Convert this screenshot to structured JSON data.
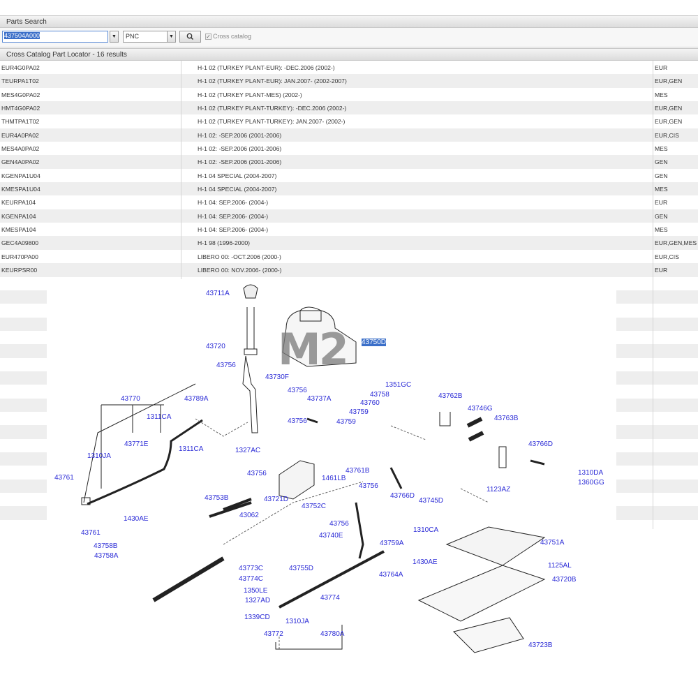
{
  "header": {
    "title": "Parts Search"
  },
  "search": {
    "value": "437504A000",
    "dropdown_value": "PNC",
    "cross_catalog_checked": true,
    "cross_catalog_label": "Cross catalog"
  },
  "results": {
    "title": "Cross Catalog Part Locator - 16 results",
    "rows": [
      {
        "catalog": "EUR4G0PA02",
        "model": "H-1 02 (TURKEY PLANT-EUR): -DEC.2006 (2002-)",
        "region": "EUR"
      },
      {
        "catalog": "TEURPA1T02",
        "model": "H-1 02 (TURKEY PLANT-EUR): JAN.2007- (2002-2007)",
        "region": "EUR,GEN"
      },
      {
        "catalog": "MES4G0PA02",
        "model": "H-1 02 (TURKEY PLANT-MES) (2002-)",
        "region": "MES"
      },
      {
        "catalog": "HMT4G0PA02",
        "model": "H-1 02 (TURKEY PLANT-TURKEY): -DEC.2006 (2002-)",
        "region": "EUR,GEN"
      },
      {
        "catalog": "THMTPA1T02",
        "model": "H-1 02 (TURKEY PLANT-TURKEY): JAN.2007- (2002-)",
        "region": "EUR,GEN"
      },
      {
        "catalog": "EUR4A0PA02",
        "model": "H-1 02: -SEP.2006 (2001-2006)",
        "region": "EUR,CIS"
      },
      {
        "catalog": "MES4A0PA02",
        "model": "H-1 02: -SEP.2006 (2001-2006)",
        "region": "MES"
      },
      {
        "catalog": "GEN4A0PA02",
        "model": "H-1 02: -SEP.2006 (2001-2006)",
        "region": "GEN"
      },
      {
        "catalog": "KGENPA1U04",
        "model": "H-1 04 SPECIAL (2004-2007)",
        "region": "GEN"
      },
      {
        "catalog": "KMESPA1U04",
        "model": "H-1 04 SPECIAL (2004-2007)",
        "region": "MES"
      },
      {
        "catalog": "KEURPA104",
        "model": "H-1 04: SEP.2006- (2004-)",
        "region": "EUR"
      },
      {
        "catalog": "KGENPA104",
        "model": "H-1 04: SEP.2006- (2004-)",
        "region": "GEN"
      },
      {
        "catalog": "KMESPA104",
        "model": "H-1 04: SEP.2006- (2004-)",
        "region": "MES"
      },
      {
        "catalog": "GEC4A09800",
        "model": "H-1 98 (1996-2000)",
        "region": "EUR,GEN,MES"
      },
      {
        "catalog": "EUR470PA00",
        "model": "LIBERO 00: -OCT.2006 (2000-)",
        "region": "EUR,CIS"
      },
      {
        "catalog": "KEURPSR00",
        "model": "LIBERO 00: NOV.2006- (2000-)",
        "region": "EUR"
      }
    ]
  },
  "diagram": {
    "watermark": "M2",
    "highlighted_part": "43750D",
    "parts": [
      "43711A",
      "43720",
      "43756",
      "43730F",
      "43756",
      "43737A",
      "1351GC",
      "43758",
      "43760",
      "43759",
      "43762B",
      "43746G",
      "43763B",
      "43770",
      "43789A",
      "1311CA",
      "43756",
      "43759",
      "43771E",
      "1311CA",
      "1327AC",
      "43766D",
      "1310JA",
      "1310DA",
      "1360GG",
      "43761",
      "43756",
      "1461LB",
      "43761B",
      "1123AZ",
      "43756",
      "43766D",
      "43745D",
      "43753B",
      "43721D",
      "43752C",
      "43062",
      "1310CA",
      "43756",
      "43761",
      "1430AE",
      "43740E",
      "43751A",
      "43758B",
      "43758A",
      "43759A",
      "43773C",
      "43755D",
      "1430AE",
      "1125AL",
      "43774C",
      "43764A",
      "43720B",
      "1350LE",
      "1327AD",
      "43774",
      "1339CD",
      "1310JA",
      "43772",
      "43780A",
      "43723B"
    ]
  }
}
